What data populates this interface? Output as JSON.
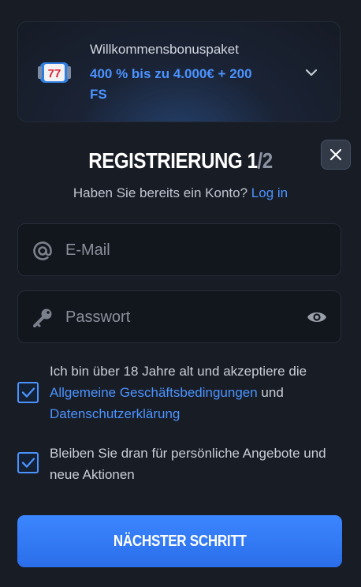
{
  "bonus": {
    "title": "Willkommensbonuspaket",
    "offer": "400 % bis zu 4.000€ + 200 FS",
    "icon": "slot-machine-777-icon",
    "expand_icon": "chevron-down-icon"
  },
  "close_icon": "close-icon",
  "heading": {
    "main": "REGISTRIERUNG 1",
    "separator": "/",
    "total": "2"
  },
  "login": {
    "prompt": "Haben Sie bereits ein Konto?",
    "link": "Log in"
  },
  "form": {
    "email_placeholder": "E-Mail",
    "password_placeholder": "Passwort"
  },
  "consent": {
    "terms_before": "Ich bin über 18 Jahre alt und akzeptiere die",
    "terms_link": "Allgemeine Geschäftsbedingungen",
    "terms_and": "und",
    "privacy_link": "Datenschutzerklärung",
    "terms_checked": true,
    "newsletter_text": "Bleiben Sie dran für persönliche Angebote und neue Aktionen",
    "newsletter_checked": true
  },
  "next_button": "NÄCHSTER SCHRITT",
  "colors": {
    "accent": "#4b93ff",
    "background": "#181c25",
    "field": "#12161d",
    "button": "#3b86ff"
  }
}
